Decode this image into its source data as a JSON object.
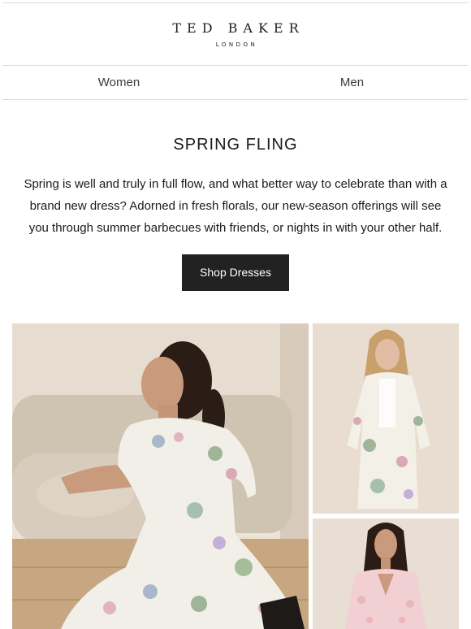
{
  "header": {
    "brand": "TED BAKER",
    "brand_sub": "LONDON"
  },
  "nav": {
    "items": [
      {
        "label": "Women"
      },
      {
        "label": "Men"
      }
    ]
  },
  "hero": {
    "headline": "SPRING FLING",
    "body": "Spring is well and truly in full flow, and what better way to celebrate than with a brand new dress? Adorned in fresh florals, our new-season offerings will see you through summer barbecues with friends, or nights in with your other half.",
    "cta_label": "Shop Dresses"
  },
  "images": [
    {
      "name": "model-seated-floral-midi-dress"
    },
    {
      "name": "model-standing-floral-shirt-dress"
    },
    {
      "name": "model-pink-lace-dress"
    }
  ],
  "colors": {
    "cta_background": "#222222",
    "cta_text": "#ffffff",
    "divider": "#dcdcdc"
  }
}
